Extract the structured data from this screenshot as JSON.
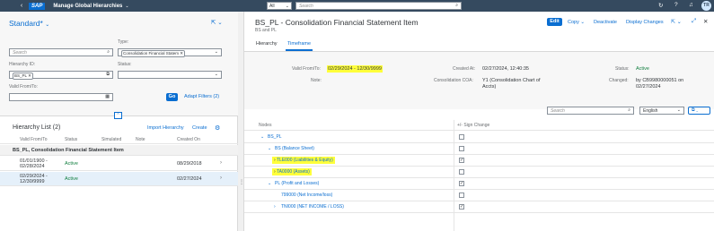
{
  "shell": {
    "app_title": "Manage Global Hierarchies",
    "logo": "SAP",
    "scope": "All",
    "search_placeholder": "Search",
    "avatar": "TR"
  },
  "left": {
    "variant": "Standard",
    "variant_mark": "*",
    "filters": {
      "search_placeholder": "Search",
      "type_label": "Type:",
      "type_value": "Consolidation Financial Statem",
      "hierarchy_id_label": "Hierarchy ID:",
      "hierarchy_id_value": "BS_PL",
      "status_label": "Status:",
      "valid_label": "Valid From/To:",
      "go": "Go",
      "adapt": "Adapt Filters (2)"
    },
    "list": {
      "title": "Hierarchy List (2)",
      "import": "Import Hierarchy",
      "create": "Create",
      "columns": [
        "Valid From/To",
        "Status",
        "Simulated",
        "Note",
        "Created On"
      ],
      "group_title": "BS_PL, Consolidation Financial Statement Item",
      "rows": [
        {
          "valid1": "01/01/1900 -",
          "valid2": "02/28/2024",
          "status": "Active",
          "created": "08/29/2018"
        },
        {
          "valid1": "02/29/2024 -",
          "valid2": "12/30/9999",
          "status": "Active",
          "created": "02/27/2024"
        }
      ]
    }
  },
  "right": {
    "title": "BS_PL - Consolidation Financial Statement Item",
    "subtitle": "BS and PL",
    "actions": {
      "edit": "Edit",
      "copy": "Copy",
      "deactivate": "Deactivate",
      "display_changes": "Display Changes"
    },
    "tabs": [
      "Hierarchy",
      "Timeframe"
    ],
    "header": {
      "valid_label": "Valid From/To:",
      "valid_value": "02/29/2024 - 12/30/9999",
      "note_label": "Note:",
      "created_label": "Created At:",
      "created_value": "02/27/2024, 12:40:35",
      "coa_label": "Consolidation COA:",
      "coa_value_1": "Y1 (Consolidation Chart of",
      "coa_value_2": "Accts)",
      "status_label": "Status:",
      "status_value": "Active",
      "changed_label": "Changed:",
      "changed_value_1": "by CB9980000051 on",
      "changed_value_2": "02/27/2024"
    },
    "toolbar": {
      "search_placeholder": "Search",
      "language": "English"
    },
    "tree": {
      "col_nodes": "Nodes",
      "col_sign": "+/- Sign Change",
      "rows": [
        {
          "label": "BS_PL",
          "checked": false,
          "highlight": false
        },
        {
          "label": "BS (Balance Sheet)",
          "checked": false,
          "highlight": false
        },
        {
          "label": "TLE000 (Liabilities & Equity)",
          "checked": true,
          "highlight": true
        },
        {
          "label": "TA0000 (Assets)",
          "checked": false,
          "highlight": true
        },
        {
          "label": "PL (Profit and Losses)",
          "checked": true,
          "highlight": false
        },
        {
          "label": "799000 (Net Income/loss)",
          "checked": false,
          "highlight": false
        },
        {
          "label": "TNI000 (NET INCOME / LOSS)",
          "checked": true,
          "highlight": false
        }
      ]
    }
  },
  "colors": {
    "shell": "#354a5f",
    "accent": "#0a6ed1",
    "positive": "#107e3e",
    "highlight": "#ffff3a"
  }
}
